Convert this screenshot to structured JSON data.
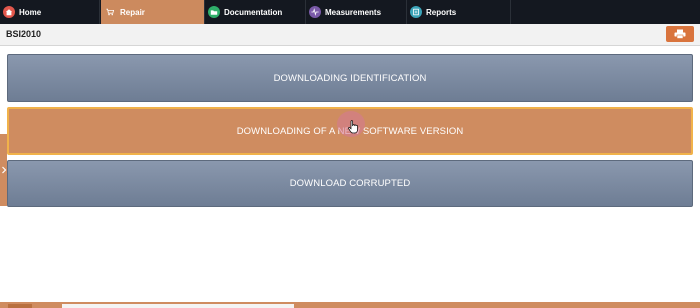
{
  "nav": {
    "tabs": [
      {
        "label": "Home",
        "icon": "home-icon"
      },
      {
        "label": "Repair",
        "icon": "cart-icon"
      },
      {
        "label": "Documentation",
        "icon": "folder-icon"
      },
      {
        "label": "Measurements",
        "icon": "waveform-icon"
      },
      {
        "label": "Reports",
        "icon": "report-icon"
      }
    ],
    "active": "Repair"
  },
  "header": {
    "title": "BSI2010",
    "print_icon": "printer-icon"
  },
  "main": {
    "options": [
      {
        "label": "DOWNLOADING IDENTIFICATION",
        "state": "normal"
      },
      {
        "label": "DOWNLOADING OF A NEW SOFTWARE VERSION",
        "state": "hover"
      },
      {
        "label": "DOWNLOAD CORRUPTED",
        "state": "normal"
      }
    ]
  },
  "colors": {
    "accent": "#cf8c60",
    "nav_bg": "#141820",
    "option_grey": "#7b8aa1",
    "hover_border": "#f1b24a"
  }
}
